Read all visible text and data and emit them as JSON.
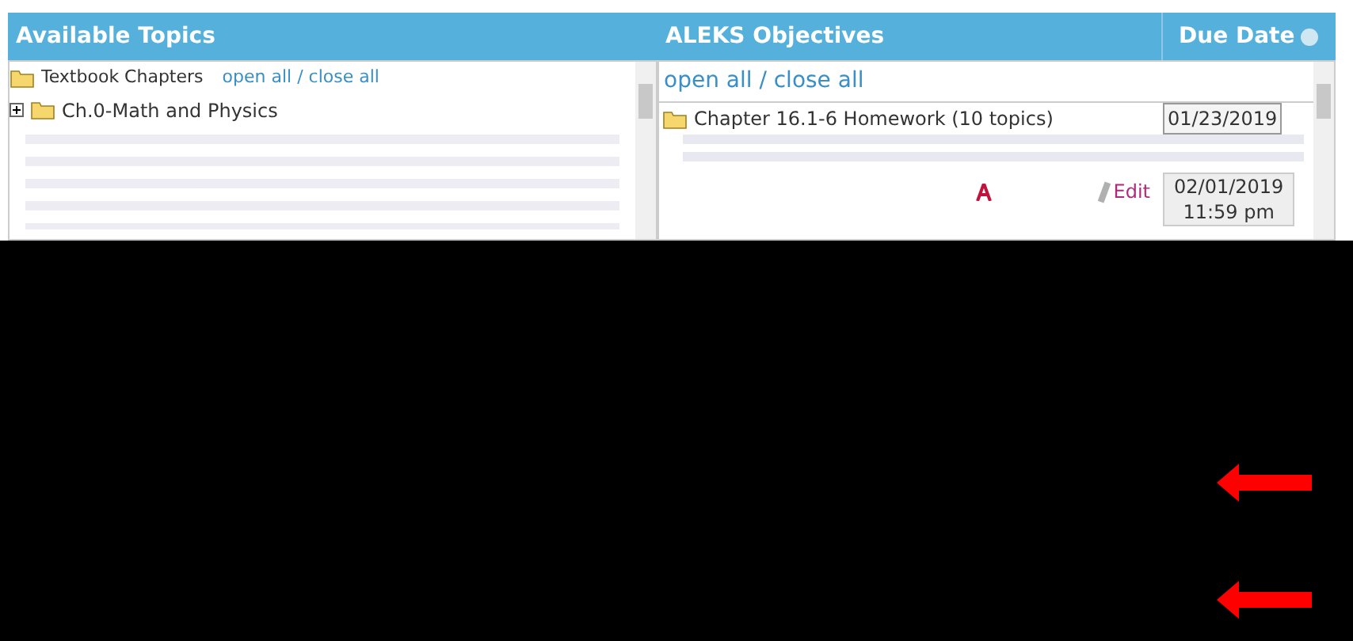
{
  "header": {
    "available_topics": "Available Topics",
    "objectives": "ALEKS Objectives",
    "due_date": "Due Date"
  },
  "topics": {
    "root": "Textbook Chapters",
    "toggle": "open all / close all",
    "items": [
      {
        "label": "Ch.0-Math and Physics",
        "expanded": false
      }
    ]
  },
  "objectives": {
    "toggle": "open all / close all",
    "rows": [
      {
        "label": "Chapter 16.1-6 Homework (10 topics)",
        "date": "01/23/2019"
      },
      {
        "action": "Edit",
        "date": "02/01/2019",
        "time": "11:59 pm"
      }
    ]
  }
}
